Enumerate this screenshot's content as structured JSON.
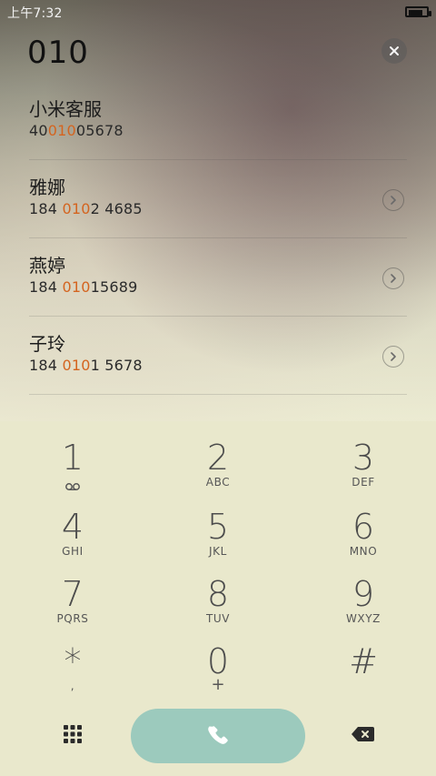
{
  "status_bar": {
    "time": "上午7:32",
    "battery_level": 0.85
  },
  "dialer": {
    "input_value": "010"
  },
  "contacts": [
    {
      "name": "小米客服",
      "number_parts": [
        "40",
        "010",
        "05678"
      ]
    },
    {
      "name": "雅娜",
      "number_parts": [
        "184 ",
        "010",
        "2 4685"
      ]
    },
    {
      "name": "燕婷",
      "number_parts": [
        "184 ",
        "010",
        "15689"
      ]
    },
    {
      "name": "子玲",
      "number_parts": [
        "184 ",
        "010",
        "1 5678"
      ]
    }
  ],
  "keypad": {
    "keys": [
      {
        "digit": "1",
        "letters": ""
      },
      {
        "digit": "2",
        "letters": "ABC"
      },
      {
        "digit": "3",
        "letters": "DEF"
      },
      {
        "digit": "4",
        "letters": "GHI"
      },
      {
        "digit": "5",
        "letters": "JKL"
      },
      {
        "digit": "6",
        "letters": "MNO"
      },
      {
        "digit": "7",
        "letters": "PQRS"
      },
      {
        "digit": "8",
        "letters": "TUV"
      },
      {
        "digit": "9",
        "letters": "WXYZ"
      },
      {
        "digit": "*",
        "letters": ","
      },
      {
        "digit": "0",
        "letters": "+"
      },
      {
        "digit": "#",
        "letters": ""
      }
    ]
  },
  "theme": {
    "accent_orange": "#d4641f",
    "call_button": "#9ccabd",
    "keypad_bg": "#e9e8cc"
  }
}
